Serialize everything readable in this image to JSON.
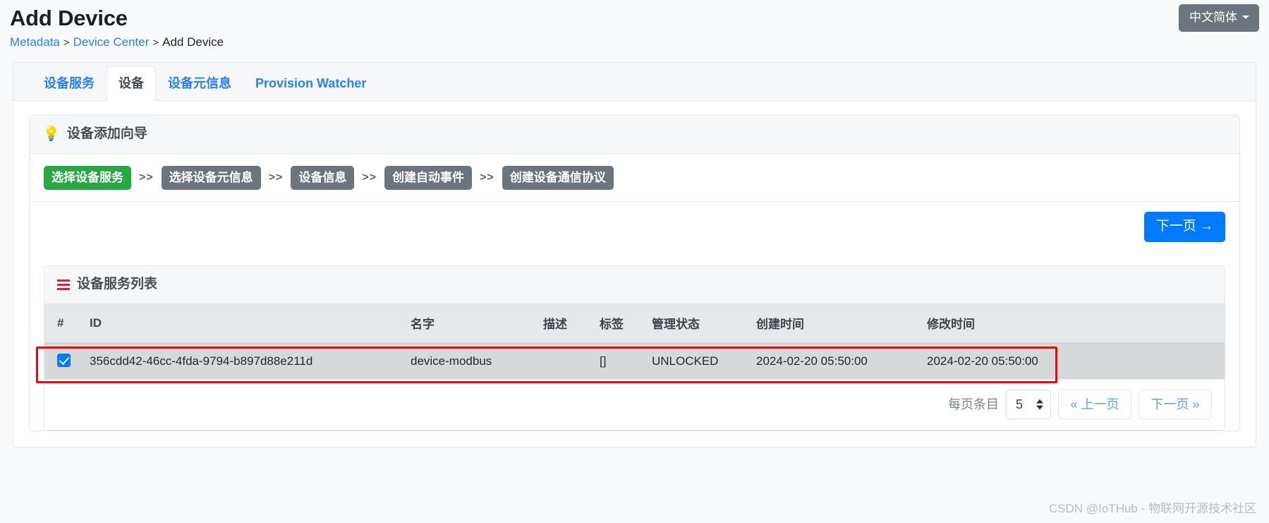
{
  "header": {
    "title": "Add Device",
    "breadcrumb": [
      {
        "label": "Metadata",
        "link": true
      },
      {
        "label": "Device Center",
        "link": true
      },
      {
        "label": "Add Device",
        "link": false
      }
    ],
    "separator": ">",
    "language_button": "中文简体"
  },
  "tabs": [
    {
      "label": "设备服务",
      "active": false
    },
    {
      "label": "设备",
      "active": true
    },
    {
      "label": "设备元信息",
      "active": false
    },
    {
      "label": "Provision Watcher",
      "active": false
    }
  ],
  "wizard": {
    "title": "设备添加向导",
    "icon": "lightbulb-icon",
    "separator": ">>",
    "steps": [
      {
        "label": "选择设备服务",
        "state": "active"
      },
      {
        "label": "选择设备元信息",
        "state": "pending"
      },
      {
        "label": "设备信息",
        "state": "pending"
      },
      {
        "label": "创建自动事件",
        "state": "pending"
      },
      {
        "label": "创建设备通信协议",
        "state": "pending"
      }
    ],
    "next_button": "下一页 →"
  },
  "list": {
    "title": "设备服务列表",
    "icon": "list-icon",
    "columns": [
      "#",
      "ID",
      "名字",
      "描述",
      "标签",
      "管理状态",
      "创建时间",
      "修改时间"
    ],
    "rows": [
      {
        "selected": true,
        "id": "356cdd42-46cc-4fda-9794-b897d88e211d",
        "name": "device-modbus",
        "description": "",
        "labels": "[]",
        "admin_state": "UNLOCKED",
        "created": "2024-02-20 05:50:00",
        "modified": "2024-02-20 05:50:00"
      }
    ]
  },
  "pagination": {
    "per_page_label": "每页条目",
    "per_page_value": "5",
    "prev_label": "« 上一页",
    "next_label": "下一页 »"
  },
  "watermark": "CSDN @IoTHub - 物联网开源技术社区",
  "colors": {
    "link": "#2a7fff",
    "primary": "#007bff",
    "active_step": "#28a745",
    "pending_step": "#6c757d",
    "highlight": "#fb0007",
    "icon_red": "#d9243c"
  }
}
